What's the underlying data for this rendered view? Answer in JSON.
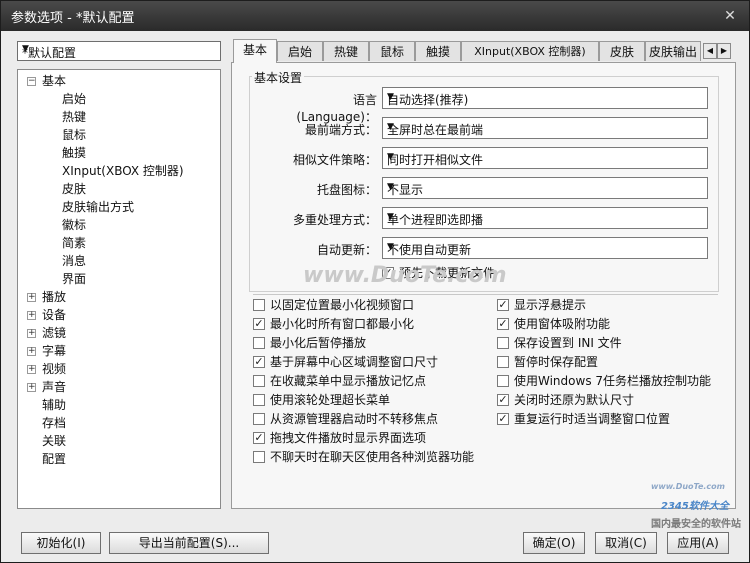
{
  "window": {
    "title": "参数选项 - *默认配置"
  },
  "profile": {
    "value": "*默认配置"
  },
  "tree": {
    "root": "基本",
    "children": [
      "启始",
      "热键",
      "鼠标",
      "触摸",
      "XInput(XBOX 控制器)",
      "皮肤",
      "皮肤输出方式",
      "徽标",
      "简素",
      "消息",
      "界面"
    ],
    "expandable": [
      "播放",
      "设备",
      "滤镜",
      "字幕",
      "视频",
      "声音"
    ],
    "leaf": [
      "辅助",
      "存档",
      "关联",
      "配置"
    ]
  },
  "tabs": [
    "基本",
    "启始",
    "热键",
    "鼠标",
    "触摸",
    "XInput(XBOX 控制器)",
    "皮肤",
    "皮肤输出"
  ],
  "basic": {
    "group_title": "基本设置",
    "rows": [
      {
        "label": "语言(Language)：",
        "value": "自动选择(推荐)"
      },
      {
        "label": "最前端方式：",
        "value": "全屏时总在最前端"
      },
      {
        "label": "相似文件策略：",
        "value": "同时打开相似文件"
      },
      {
        "label": "托盘图标：",
        "value": "不显示"
      },
      {
        "label": "多重处理方式：",
        "value": "单个进程即选即播"
      },
      {
        "label": "自动更新：",
        "value": "不使用自动更新"
      }
    ],
    "predownload": {
      "label": "预先下载更新文件",
      "checked": true
    }
  },
  "options_left": [
    {
      "label": "以固定位置最小化视频窗口",
      "checked": false
    },
    {
      "label": "最小化时所有窗口都最小化",
      "checked": true
    },
    {
      "label": "最小化后暂停播放",
      "checked": false
    },
    {
      "label": "基于屏幕中心区域调整窗口尺寸",
      "checked": true
    },
    {
      "label": "在收藏菜单中显示播放记忆点",
      "checked": false
    },
    {
      "label": "使用滚轮处理超长菜单",
      "checked": false
    },
    {
      "label": "从资源管理器启动时不转移焦点",
      "checked": false
    },
    {
      "label": "拖拽文件播放时显示界面选项",
      "checked": true
    },
    {
      "label": "不聊天时在聊天区使用各种浏览器功能",
      "checked": false
    }
  ],
  "options_right": [
    {
      "label": "显示浮悬提示",
      "checked": true
    },
    {
      "label": "使用窗体吸附功能",
      "checked": true
    },
    {
      "label": "保存设置到 INI 文件",
      "checked": false
    },
    {
      "label": "暂停时保存配置",
      "checked": false
    },
    {
      "label": "使用Windows 7任务栏播放控制功能",
      "checked": false
    },
    {
      "label": "关闭时还原为默认尺寸",
      "checked": true
    },
    {
      "label": "重复运行时适当调整窗口位置",
      "checked": true
    }
  ],
  "buttons": {
    "init": "初始化(I)",
    "export": "导出当前配置(S)...",
    "ok": "确定(O)",
    "cancel": "取消(C)",
    "apply": "应用(A)"
  },
  "watermarks": [
    "www.DuoTe.com",
    "www.DuoTe.com",
    "2345软件大全",
    "国内最安全的软件站"
  ]
}
